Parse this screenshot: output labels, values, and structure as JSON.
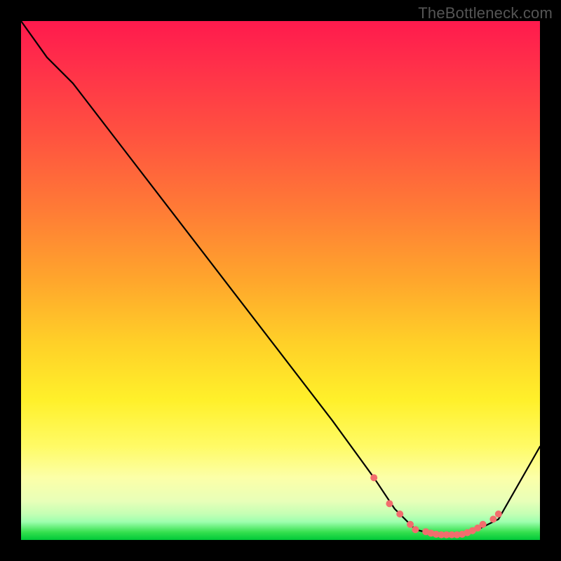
{
  "watermark": "TheBottleneck.com",
  "chart_data": {
    "type": "line",
    "title": "",
    "xlabel": "",
    "ylabel": "",
    "xlim": [
      0,
      100
    ],
    "ylim": [
      0,
      100
    ],
    "grid": false,
    "legend": false,
    "series": [
      {
        "name": "curve",
        "x": [
          0,
          5,
          10,
          20,
          30,
          40,
          50,
          60,
          68,
          72,
          76,
          80,
          84,
          88,
          92,
          100
        ],
        "y": [
          100,
          93,
          88,
          75,
          62,
          49,
          36,
          23,
          12,
          6,
          2,
          1,
          1,
          2,
          4,
          18
        ]
      }
    ],
    "markers": {
      "name": "dots",
      "color": "#f26d6d",
      "x": [
        68,
        71,
        73,
        75,
        76,
        78,
        79,
        80,
        81,
        82,
        83,
        84,
        85,
        86,
        87,
        88,
        89,
        91,
        92
      ],
      "y": [
        12,
        7,
        5,
        3,
        2,
        1.6,
        1.3,
        1.1,
        1.0,
        1.0,
        1.0,
        1.0,
        1.1,
        1.4,
        1.8,
        2.3,
        3.0,
        4.0,
        5.0
      ]
    }
  }
}
